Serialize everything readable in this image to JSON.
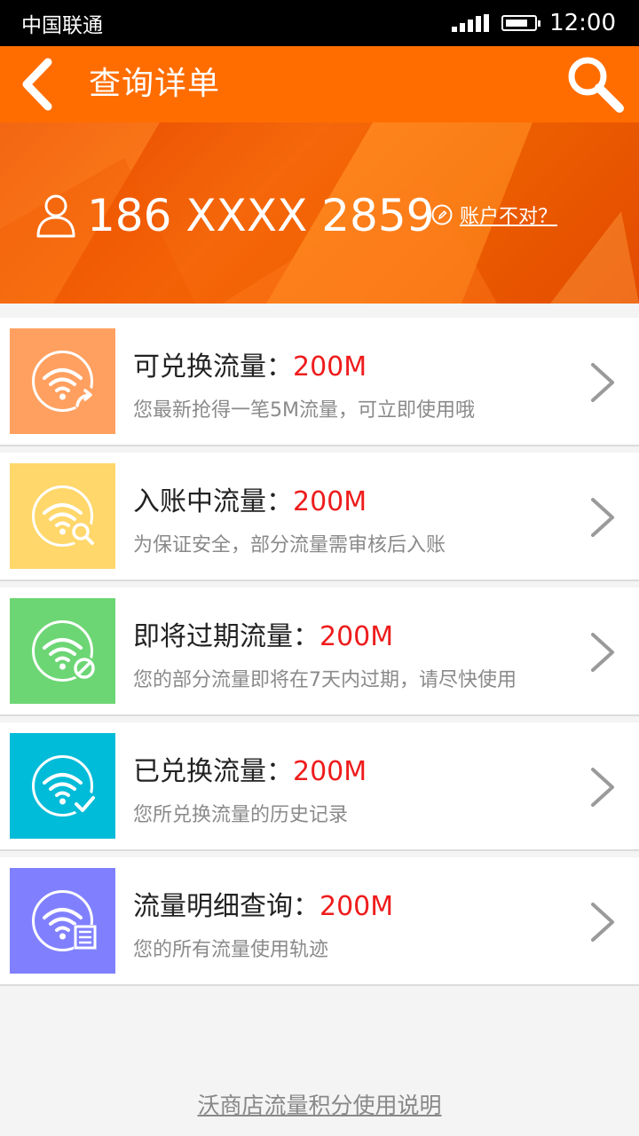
{
  "status_bar": {
    "carrier": "中国联通",
    "time": "12:00",
    "signal_icon": "signal-bars-icon",
    "battery_icon": "battery-icon"
  },
  "header": {
    "title": "查询详单",
    "back_icon": "chevron-left-icon",
    "search_icon": "search-icon",
    "background": "#ff6d00"
  },
  "account": {
    "phone": "186 XXXX 2859",
    "wrong_account_label": "账户不对？",
    "user_icon": "user-icon",
    "edit_icon": "edit-icon"
  },
  "items": [
    {
      "title": "可兑换流量：",
      "value": "200M",
      "description": "您最新抢得一笔5M流量，可立即使用哦",
      "color": "#ffa060",
      "icon": "wifi-share-icon"
    },
    {
      "title": "入账中流量：",
      "value": "200M",
      "description": "为保证安全，部分流量需审核后入账",
      "color": "#ffd76a",
      "icon": "wifi-search-icon"
    },
    {
      "title": "即将过期流量：",
      "value": "200M",
      "description": "您的部分流量即将在7天内过期，请尽快使用",
      "color": "#6cd674",
      "icon": "wifi-expire-icon"
    },
    {
      "title": "已兑换流量：",
      "value": "200M",
      "description": "您所兑换流量的历史记录",
      "color": "#00bcd8",
      "icon": "wifi-check-icon"
    },
    {
      "title": "流量明细查询：",
      "value": "200M",
      "description": "您的所有流量使用轨迹",
      "color": "#8080ff",
      "icon": "wifi-detail-icon"
    }
  ],
  "footer": {
    "link_label": "沃商店流量积分使用说明"
  },
  "colors": {
    "value_red": "#ee1c1c",
    "accent": "#ff6d00"
  }
}
